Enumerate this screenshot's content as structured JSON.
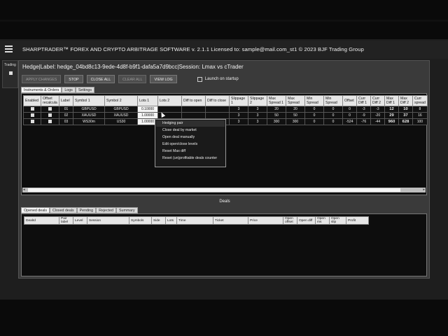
{
  "app": {
    "title": "SHARPTRADER™ FOREX AND CRYPTO ARBITRAGE SOFTWARE v. 2.1.1 Licensed to: sample@mail.com_st1 © 2023 BJF Trading Group",
    "left_strip_label": "Trading"
  },
  "window": {
    "title": "Hedge|Label: hedge_04bd8c13-9ede-4d8f-b9f1-dafa5a7d9bcc|Session: Lmax vs cTrader"
  },
  "toolbar": {
    "apply": "APPLY CHANGES",
    "stop": "STOP",
    "close_all": "CLOSE ALL",
    "clear_all": "CLEAR ALL",
    "view_log": "VIEW LOG",
    "launch_on_startup": "Launch on startup"
  },
  "tabs_top": [
    "Instruments & Orders",
    "Logs",
    "Settings"
  ],
  "pairs_table": {
    "columns": [
      "Enabled",
      "Offset recalcula",
      "Label",
      "Symbol 1",
      "Symbol 2",
      "Lots 1",
      "Lots 2",
      "Diff to open",
      "Diff to close",
      "Slippage 1",
      "Slippage 2",
      "Max Spread 1",
      "Max Spread",
      "Min Spread",
      "Min Spread",
      "Offset",
      "Curr Diff 1",
      "Curr Diff 2",
      "Max Diff 1",
      "Max Diff 2",
      "Curr spread"
    ],
    "rows": [
      [
        "",
        "",
        "01",
        "GBPUSD",
        "GBPUSD",
        "0.10000",
        "",
        "",
        "",
        "3",
        "3",
        "20",
        "20",
        "0",
        "0",
        "0",
        "-3",
        "-3",
        "12",
        "10",
        "8"
      ],
      [
        "",
        "",
        "02",
        "XAUUSD",
        "XAUUSD",
        "1.00000",
        "",
        "",
        "",
        "3",
        "3",
        "50",
        "50",
        "0",
        "0",
        "0",
        "-9",
        "-20",
        "29",
        "37",
        "16"
      ],
      [
        "",
        "",
        "03",
        "WS30m",
        "US30",
        "1.00000",
        "",
        "",
        "",
        "3",
        "3",
        "300",
        "300",
        "0",
        "0",
        "-524",
        "-76",
        "-44",
        "960",
        "628",
        "100"
      ]
    ]
  },
  "context_menu": {
    "items": [
      "Hedging pair",
      "Close deal by market",
      "Open deal manually",
      "Edit open/close levels",
      "Reset Max diff",
      "Reset (un)profitable deals counter"
    ]
  },
  "deals": {
    "label": "Deals",
    "tabs": [
      "Opened deals",
      "Closed deals",
      "Pending",
      "Rejected",
      "Summary"
    ],
    "columns": [
      "DealId",
      "Pair label",
      "Level",
      "Session",
      "Symbols",
      "Side",
      "Lots",
      "Time",
      "Ticket",
      "Price",
      "Open offset",
      "Open diff",
      "Open ms",
      "Open slip",
      "Profit"
    ]
  },
  "colors": {
    "window_bg": "#3a3a3a",
    "grid_bg": "#0d0d0d",
    "header_bg": "#e6e6e6"
  }
}
